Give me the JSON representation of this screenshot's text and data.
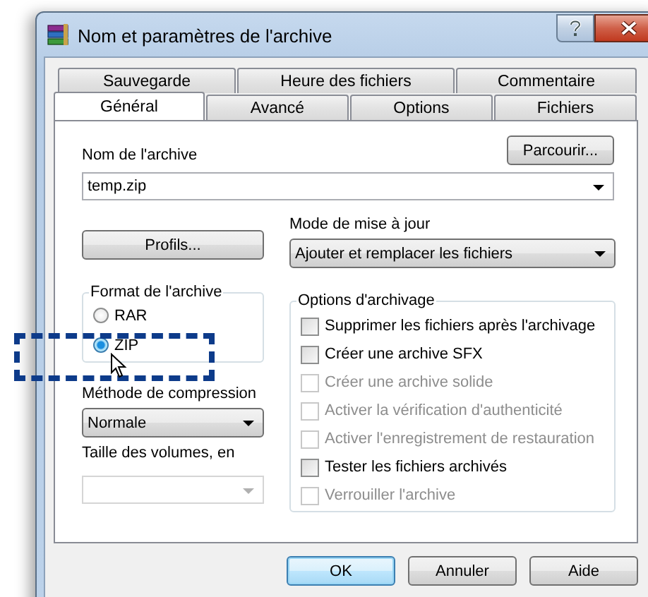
{
  "window": {
    "title": "Nom et paramètres de l'archive"
  },
  "tab_rows": [
    {
      "tabs": [
        {
          "label": "Sauvegarde",
          "selected": false
        },
        {
          "label": "Heure des fichiers",
          "selected": false
        },
        {
          "label": "Commentaire",
          "selected": false
        }
      ]
    },
    {
      "tabs": [
        {
          "label": "Général",
          "selected": true
        },
        {
          "label": "Avancé",
          "selected": false
        },
        {
          "label": "Options",
          "selected": false
        },
        {
          "label": "Fichiers",
          "selected": false
        }
      ]
    }
  ],
  "archive_name": {
    "label": "Nom de l'archive",
    "value": "temp.zip"
  },
  "browse_button": "Parcourir...",
  "profiles_button": "Profils...",
  "update_mode": {
    "label": "Mode de mise à jour",
    "value": "Ajouter et remplacer les fichiers"
  },
  "archive_format": {
    "legend": "Format de l'archive",
    "options": [
      {
        "label": "RAR",
        "selected": false
      },
      {
        "label": "ZIP",
        "selected": true
      }
    ]
  },
  "compression": {
    "label": "Méthode de compression",
    "value": "Normale"
  },
  "volume_size": {
    "label": "Taille des volumes, en",
    "disabled": true
  },
  "archive_options": {
    "legend": "Options d'archivage",
    "items": [
      {
        "label": "Supprimer les fichiers après l'archivage",
        "checked": false,
        "disabled": false
      },
      {
        "label": "Créer une archive SFX",
        "checked": false,
        "disabled": false
      },
      {
        "label": "Créer une archive solide",
        "checked": false,
        "disabled": true
      },
      {
        "label": "Activer la vérification d'authenticité",
        "checked": false,
        "disabled": true
      },
      {
        "label": "Activer l'enregistrement de restauration",
        "checked": false,
        "disabled": true
      },
      {
        "label": "Tester les fichiers archivés",
        "checked": false,
        "disabled": false
      },
      {
        "label": "Verrouiller l'archive",
        "checked": false,
        "disabled": true
      }
    ]
  },
  "buttons": [
    {
      "label": "OK",
      "default": true
    },
    {
      "label": "Annuler",
      "default": false
    },
    {
      "label": "Aide",
      "default": false
    }
  ]
}
